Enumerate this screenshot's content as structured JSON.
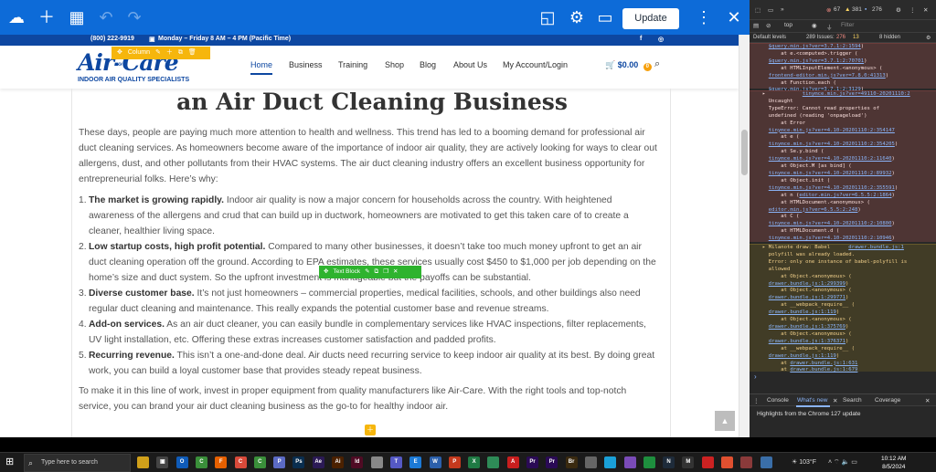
{
  "editor": {
    "update_label": "Update",
    "colors": {
      "toolbar": "#0d6bd8",
      "update_text": "#1e2b3a"
    }
  },
  "site": {
    "topbar": {
      "phone": "(800) 222-9919",
      "hours": "Monday – Friday 8 AM – 4 PM (Pacific Time)",
      "social_fb": "f",
      "social_ig": "◎"
    },
    "logo": {
      "name": "Air-Care",
      "tagline": "INDOOR AIR QUALITY SPECIALISTS"
    },
    "column_tools_label": "Column",
    "row_label": "Row",
    "nav": [
      "Home",
      "Business",
      "Training",
      "Shop",
      "Blog",
      "About Us",
      "My Account/Login"
    ],
    "cart": {
      "amount": "$0.00",
      "count": "0"
    },
    "colors": {
      "brand": "#0d47a1",
      "accent": "#f6a00d",
      "editor_green": "#2eb32e"
    }
  },
  "article": {
    "title": "an Air Duct Cleaning Business",
    "intro": "These days, people are paying much more attention to health and wellness. This trend has led to a booming demand for professional air duct cleaning services. As homeowners become aware of the importance of indoor air quality, they are actively looking for ways to clear out allergens, dust, and other pollutants from their HVAC systems. The air duct cleaning industry offers an excellent business opportunity for entrepreneurial folks. Here’s why:",
    "items": [
      {
        "num": "1.",
        "head": "The market is growing rapidly.",
        "body": " Indoor air quality is now a major concern for households across the country. With heightened awareness of the allergens and crud that can build up in ductwork, homeowners are motivated to get this taken care of to create a cleaner, healthier living space."
      },
      {
        "num": "2.",
        "head": "Low startup costs, high profit potential.",
        "body": " Compared to many other businesses, it doesn’t take too much money upfront to get an air duct cleaning operation off the ground. According to EPA estimates, these services usually cost $450 to $1,000 per job depending on the home’s size and duct system. So the upfront investment is manageable but the payoffs can be substantial."
      },
      {
        "num": "3.",
        "head": "Diverse customer base.",
        "body": " It’s not just homeowners – commercial properties, medical facilities, schools, and other buildings also need regular duct cleaning and maintenance. This really expands the potential customer base and revenue streams."
      },
      {
        "num": "4.",
        "head": "Add-on services.",
        "body": " As an air duct cleaner, you can easily bundle in complementary services like HVAC inspections, filter replacements, UV light installation, etc. Offering these extras increases customer satisfaction and padded profits."
      },
      {
        "num": "5.",
        "head": "Recurring revenue.",
        "body": " This isn’t a one-and-done deal. Air ducts need recurring service to keep indoor air quality at its best. By doing great work, you can build a loyal customer base that provides steady repeat business."
      }
    ],
    "outro": "To make it in this line of work, invest in proper equipment from quality manufacturers like Air-Care. With the right tools and top-notch service, you can brand your air duct cleaning business as the go-to for healthy indoor air.",
    "text_block_label": "Text Block"
  },
  "devtools": {
    "errors": "67",
    "warnings": "381",
    "info": "276",
    "context": "top",
    "filter_placeholder": "Filter",
    "levels_label": "Default levels",
    "issues": "289 Issues:",
    "issues_err": "276",
    "issues_warn": "13",
    "hidden": "8 hidden",
    "log_err1": "  $query.min.js?ver=3.7.1:2:1594)\n      at e.<computed>.trigger (\n  $query.min.js?ver=3.7.1:2:70701)\n      at HTMLInputElement.<anonymous> (\n  frontend-editor.min.js?ver=7.8.0:41313)\n      at Function.each (\n  $query.min.js?ver=3.7.1:2:3129)",
    "log_err2": "▸            tinymce.min.js?ver=49110-20201110:2\n  Uncaught\n  TypeError: Cannot read properties of\n  undefined (reading 'onpageload')\n      at Error\n  tinymce.min.js?ver=4.10-20201110:2:354147\n      at e (\n  tinymce.min.js?ver=4.10-20201110:2:354205)\n      at Se.y.bind (\n  tinymce.min.js?ver=4.10-20201110:2:11640)\n      at Object.M [as bind] (\n  tinymce.min.js?ver=4.10-20201110:2:89932)\n      at Object.init (\n  tinymce.min.js?ver=4.10-20201110:2:355591)\n      at n (editor.min.js?ver=6.5.5:2:1864)\n      at HTMLDocument.<anonymous> (\n  editor.min.js?ver=6.5.5:2:248)\n      at C (\n  tinymce.min.js?ver=4.10-20201110:2:10800)\n      at HTMLDocument.d (\n  tinymce.min.js?ver=4.10-20201110:2:10946)",
    "log_warn": "▸ Milanote draw: Babel      drawer.bundle.js:1\n  polyfill was already loaded.\n  Error: only one instance of babel-polyfill is\n  allowed\n      at Object.<anonymous> (\n  drawer.bundle.js:1:299399)\n      at Object.<anonymous> (\n  drawer.bundle.js:1:299771)\n      at __webpack_require__ (\n  drawer.bundle.js:1:119)\n      at Object.<anonymous> (\n  drawer.bundle.js:1:375769)\n      at Object.<anonymous> (\n  drawer.bundle.js:1:376371)\n      at __webpack_require__ (\n  drawer.bundle.js:1:119)\n      at drawer.bundle.js:1:631\n      at drawer.bundle.js:1:679",
    "prompt": "›",
    "drawer_tabs": [
      "Console",
      "What's new",
      "Search",
      "Coverage"
    ],
    "highlights": "Highlights from the Chrome 127 update"
  },
  "taskbar": {
    "search_placeholder": "Type here to search",
    "weather": "103°F",
    "time": "10:12 AM",
    "date": "8/5/2024",
    "apps": [
      {
        "label": "",
        "color": "#d0a01a",
        "icon": "folder-icon"
      },
      {
        "label": "▣",
        "color": "#444",
        "icon": "task-view-icon"
      },
      {
        "label": "O",
        "color": "#0f5bb8",
        "icon": "outlook-icon"
      },
      {
        "label": "C",
        "color": "#3a8f3a",
        "icon": "chrome-icon"
      },
      {
        "label": "F",
        "color": "#e66000",
        "icon": "firefox-icon"
      },
      {
        "label": "C",
        "color": "#d84a3a",
        "icon": "chrome-icon"
      },
      {
        "label": "C",
        "color": "#3a8f3a",
        "icon": "chrome-icon"
      },
      {
        "label": "P",
        "color": "#5b6ac4",
        "icon": "app-icon"
      },
      {
        "label": "Ps",
        "color": "#0a2e4f",
        "icon": "photoshop-icon"
      },
      {
        "label": "Ae",
        "color": "#2b1a55",
        "icon": "after-effects-icon"
      },
      {
        "label": "Ai",
        "color": "#4b2100",
        "icon": "illustrator-icon"
      },
      {
        "label": "Id",
        "color": "#4f0b24",
        "icon": "indesign-icon"
      },
      {
        "label": "",
        "color": "#888",
        "icon": "explorer-icon"
      },
      {
        "label": "T",
        "color": "#5559c4",
        "icon": "teams-icon"
      },
      {
        "label": "E",
        "color": "#1c7ad6",
        "icon": "edge-icon"
      },
      {
        "label": "W",
        "color": "#2b5faa",
        "icon": "word-icon"
      },
      {
        "label": "P",
        "color": "#c4391d",
        "icon": "powerpoint-icon"
      },
      {
        "label": "X",
        "color": "#1f7a44",
        "icon": "excel-icon"
      },
      {
        "label": "",
        "color": "#2e8b57",
        "icon": "app-icon"
      },
      {
        "label": "A",
        "color": "#c81e1e",
        "icon": "acrobat-icon"
      },
      {
        "label": "Pr",
        "color": "#2a0a55",
        "icon": "premiere-icon"
      },
      {
        "label": "Pr",
        "color": "#2a0a55",
        "icon": "premiere-icon"
      },
      {
        "label": "Br",
        "color": "#3a2a10",
        "icon": "bridge-icon"
      },
      {
        "label": "",
        "color": "#666",
        "icon": "app-icon"
      },
      {
        "label": "",
        "color": "#1aa0d8",
        "icon": "app-icon"
      },
      {
        "label": "",
        "color": "#7a4bb8",
        "icon": "app-icon"
      },
      {
        "label": "",
        "color": "#1e8e3e",
        "icon": "app-icon"
      },
      {
        "label": "N",
        "color": "#1e2b3a",
        "icon": "notes-icon"
      },
      {
        "label": "M",
        "color": "#333",
        "icon": "app-icon"
      },
      {
        "label": "",
        "color": "#c22",
        "icon": "app-icon"
      },
      {
        "label": "",
        "color": "#e05030",
        "icon": "app-icon"
      },
      {
        "label": "",
        "color": "#8a3a3a",
        "icon": "app-icon"
      },
      {
        "label": "",
        "color": "#3a6ea8",
        "icon": "app-icon"
      }
    ]
  }
}
